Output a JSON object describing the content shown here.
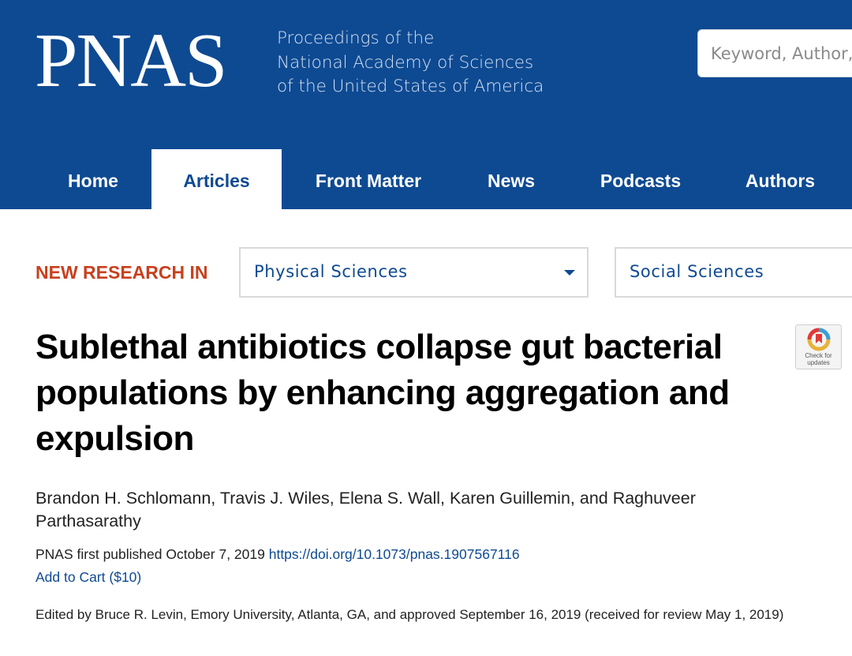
{
  "header": {
    "logo": "PNAS",
    "tagline": [
      "Proceedings of the",
      "National Academy of Sciences",
      "of the United States of America"
    ],
    "search_placeholder": "Keyword, Author, or DOI"
  },
  "nav": {
    "items": [
      {
        "label": "Home",
        "active": false
      },
      {
        "label": "Articles",
        "active": true
      },
      {
        "label": "Front Matter",
        "active": false
      },
      {
        "label": "News",
        "active": false
      },
      {
        "label": "Podcasts",
        "active": false
      },
      {
        "label": "Authors",
        "active": false
      }
    ]
  },
  "research": {
    "label": "NEW RESEARCH IN",
    "dropdowns": [
      {
        "label": "Physical Sciences"
      },
      {
        "label": "Social Sciences"
      }
    ]
  },
  "article": {
    "title": "Sublethal antibiotics collapse gut bacterial populations by enhancing aggregation and expulsion",
    "authors": "Brandon H. Schlomann, Travis J. Wiles, Elena S. Wall, Karen Guillemin, and Raghuveer Parthasarathy",
    "published_prefix": "PNAS first published October 7, 2019 ",
    "doi": "https://doi.org/10.1073/pnas.1907567116",
    "cart": "Add to Cart ($10)",
    "edited": "Edited by Bruce R. Levin, Emory University, Atlanta, GA, and approved September 16, 2019 (received for review May 1, 2019)"
  },
  "badge": {
    "line1": "Check for",
    "line2": "updates"
  },
  "colors": {
    "brand_blue": "#0e4a92",
    "accent_red": "#c8401e"
  }
}
